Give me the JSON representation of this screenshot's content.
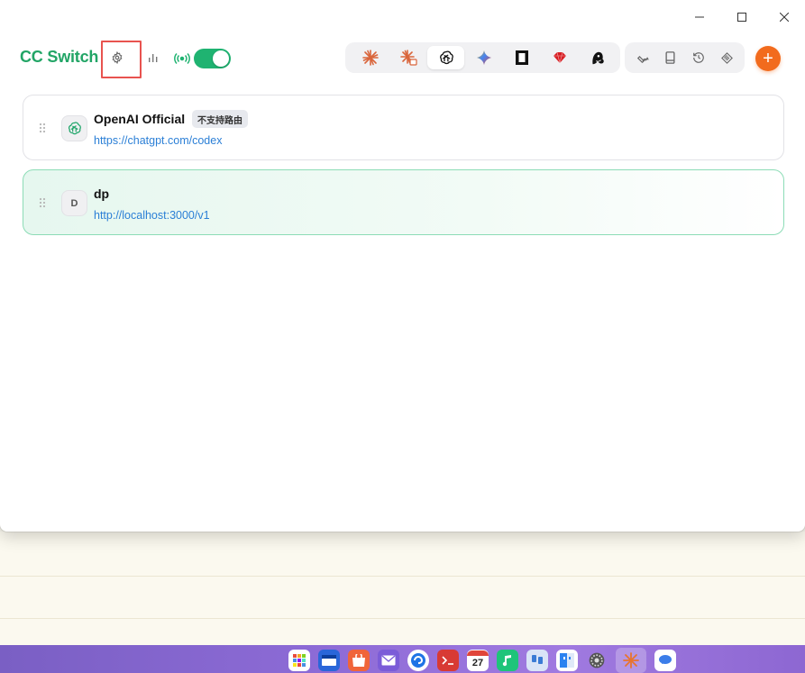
{
  "window": {
    "minimize_icon": "minimize-icon",
    "maximize_icon": "maximize-icon",
    "close_icon": "close-icon"
  },
  "header": {
    "brand": "CC Switch",
    "settings_icon": "gear-icon",
    "usage_icon": "bar-chart-icon",
    "proxy_icon": "broadcast-icon",
    "proxy_enabled": true,
    "accent_color": "#22a566"
  },
  "app_tabs": [
    {
      "name": "claude-code",
      "icon": "claude-sparkle-icon",
      "active": false
    },
    {
      "name": "claude-desktop",
      "icon": "claude-sparkle-badge-icon",
      "active": false
    },
    {
      "name": "codex",
      "icon": "openai-icon",
      "active": true
    },
    {
      "name": "gemini",
      "icon": "gemini-star-icon",
      "active": false
    },
    {
      "name": "opencode",
      "icon": "square-frame-icon",
      "active": false
    },
    {
      "name": "ruby",
      "icon": "ruby-gem-icon",
      "active": false
    },
    {
      "name": "other-app",
      "icon": "mascot-icon",
      "active": false
    }
  ],
  "tools": [
    {
      "name": "wrench",
      "icon": "wrench-icon"
    },
    {
      "name": "book",
      "icon": "book-icon"
    },
    {
      "name": "history",
      "icon": "history-icon"
    },
    {
      "name": "mcp",
      "icon": "mcp-icon"
    }
  ],
  "add_button": {
    "label": "+",
    "color": "#f26b1d"
  },
  "providers": [
    {
      "name": "OpenAI Official",
      "badge": "不支持路由",
      "url": "https://chatgpt.com/codex",
      "avatar_icon": "openai-icon",
      "active": false
    },
    {
      "name": "dp",
      "url": "http://localhost:3000/v1",
      "avatar_letter": "D",
      "active": true
    }
  ],
  "taskbar": {
    "calendar_day": "27",
    "apps": [
      "launchpad-icon",
      "files-icon",
      "store-icon",
      "mail-icon",
      "browser-icon",
      "terminal-icon",
      "calendar-icon",
      "music-icon",
      "chat-icon",
      "finder-icon",
      "settings-icon",
      "cc-switch-icon",
      "messages-icon"
    ]
  }
}
